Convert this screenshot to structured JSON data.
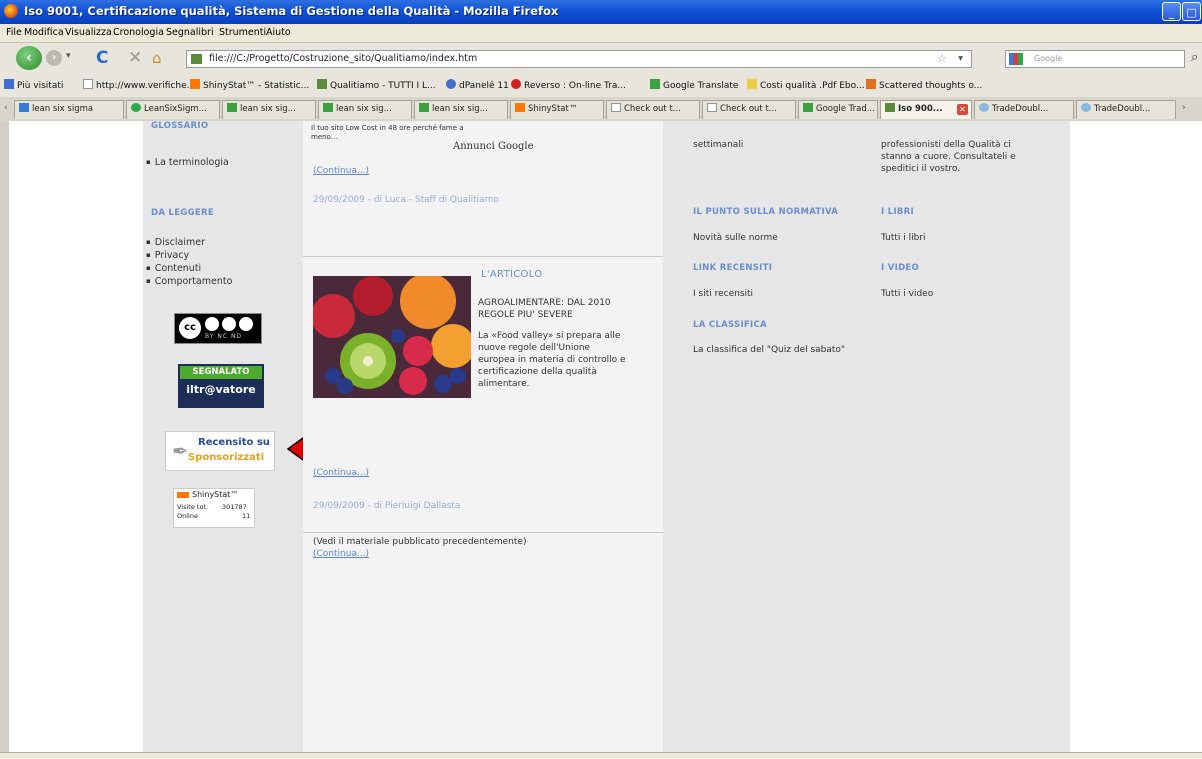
{
  "window": {
    "title": "Iso 9001, Certificazione qualità, Sistema di Gestione della Qualità - Mozilla Firefox"
  },
  "menu": [
    "File",
    "Modifica",
    "Visualizza",
    "Cronologia",
    "Segnalibri",
    "Strumenti",
    "Aiuto"
  ],
  "nav": {
    "url": "file:///C:/Progetto/Costruzione_sito/Qualitiamo/index.htm",
    "search_placeholder": "Google"
  },
  "bookmarks": [
    "Più visitati",
    "http://www.verifiche.i...",
    "ShinyStat™ - Statistic...",
    "Qualitiamo - TUTTI I L...",
    "dPanelê 11",
    "Reverso : On-line Tra...",
    "Google Translate",
    "Costi qualità .Pdf Ebo...",
    "Scattered thoughts o..."
  ],
  "tabs": [
    "lean six sigma",
    "LeanSixSigm...",
    "lean six sig...",
    "lean six sig...",
    "lean six sig...",
    "ShinyStat™",
    "Check out t...",
    "Check out t...",
    "Google Trad...",
    "Iso 900...",
    "TradeDoubl...",
    "TradeDoubl..."
  ],
  "sidebar": {
    "glossario_header": "GLOSSARIO",
    "terminologia": "La terminologia",
    "daleggere_header": "DA LEGGERE",
    "links": [
      "Disclaimer",
      "Privacy",
      "Contenuti",
      "Comportamento"
    ],
    "cc_badge": "cc",
    "cc_sub": "BY  NC  ND",
    "segnalato_top": "SEGNALATO",
    "segnalato_bottom": "iltr@vatore",
    "recensito_line1": "Recensito su",
    "recensito_line2": "Sponsorizzati",
    "shinystat_brand": "ShinyStat™",
    "shinystat_visits_label": "Visite tot.",
    "shinystat_visits": "301787",
    "shinystat_online_label": "Online",
    "shinystat_online": "11"
  },
  "main": {
    "ad_text_line1": "Il tuo sito Low Cost in 48 ore perché fame a",
    "ad_text_line2": "meno...",
    "ad_label": "Annunci Google",
    "continua1": "(Continua...)",
    "byline1": "29/09/2009 - di Luca - Staff di Qualitiamo",
    "articolo_header": "L'ARTICOLO",
    "articolo_title_line1": "AGROALIMENTARE: DAL 2010",
    "articolo_title_line2": "REGOLE PIU' SEVERE",
    "articolo_body": [
      "La «Food valley» si prepara alle",
      "nuove regole dell'Unione",
      "europea in materia di controllo e",
      "certificazione della qualità",
      "alimentare."
    ],
    "continua2": "(Continua...)",
    "byline2": "29/09/2009 - di Pierluigi Dallasta",
    "vedi": "(Vedi il materiale pubblicato precedentemente)",
    "continua3": "(Continua...)"
  },
  "right": {
    "top_left": "settimanali",
    "top_right": [
      "professionisti della Qualità ci",
      "stanno a cuore. Consultateli e",
      "speditici il vostro."
    ],
    "punto_header": "IL PUNTO SULLA NORMATIVA",
    "punto_link": "Novità sulle norme",
    "libri_header": "I LIBRI",
    "libri_link": "Tutti i libri",
    "link_header": "LINK RECENSITI",
    "link_link": "I siti recensiti",
    "video_header": "I VIDEO",
    "video_link": "Tutti i video",
    "classifica_header": "LA CLASSIFICA",
    "classifica_link": "La classifica del \"Quiz del sabato\""
  },
  "colors": {
    "annotation_arrow": "#e00000",
    "header_blue": "#6a8fcf"
  }
}
